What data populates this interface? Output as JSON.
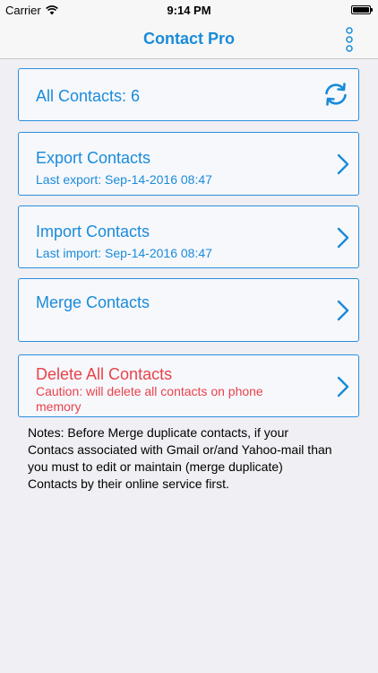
{
  "status_bar": {
    "carrier": "Carrier",
    "time": "9:14 PM",
    "battery_level": 1.0
  },
  "nav": {
    "title": "Contact Pro",
    "menu_icon": "vertical-dots-icon"
  },
  "cards": {
    "all_contacts": {
      "label": "All Contacts: 6",
      "icon": "refresh-icon"
    },
    "export": {
      "label": "Export Contacts",
      "sub": "Last export: Sep-14-2016 08:47"
    },
    "import": {
      "label": "Import Contacts",
      "sub": "Last import: Sep-14-2016 08:47"
    },
    "merge": {
      "label": "Merge Contacts"
    },
    "delete": {
      "label": "Delete All Contacts",
      "sub_line1": "Caution: will delete all contacts on phone",
      "sub_line2": "memory"
    }
  },
  "notes": {
    "line1": "Notes: Before Merge duplicate contacts, if your",
    "line2": "Contacs associated with Gmail or/and Yahoo-mail than",
    "line3": "you must to edit or maintain (merge duplicate)",
    "line4": "Contacts by their online service first."
  },
  "colors": {
    "accent": "#1a8bd9",
    "danger": "#e8424b",
    "background": "#efeff4"
  }
}
